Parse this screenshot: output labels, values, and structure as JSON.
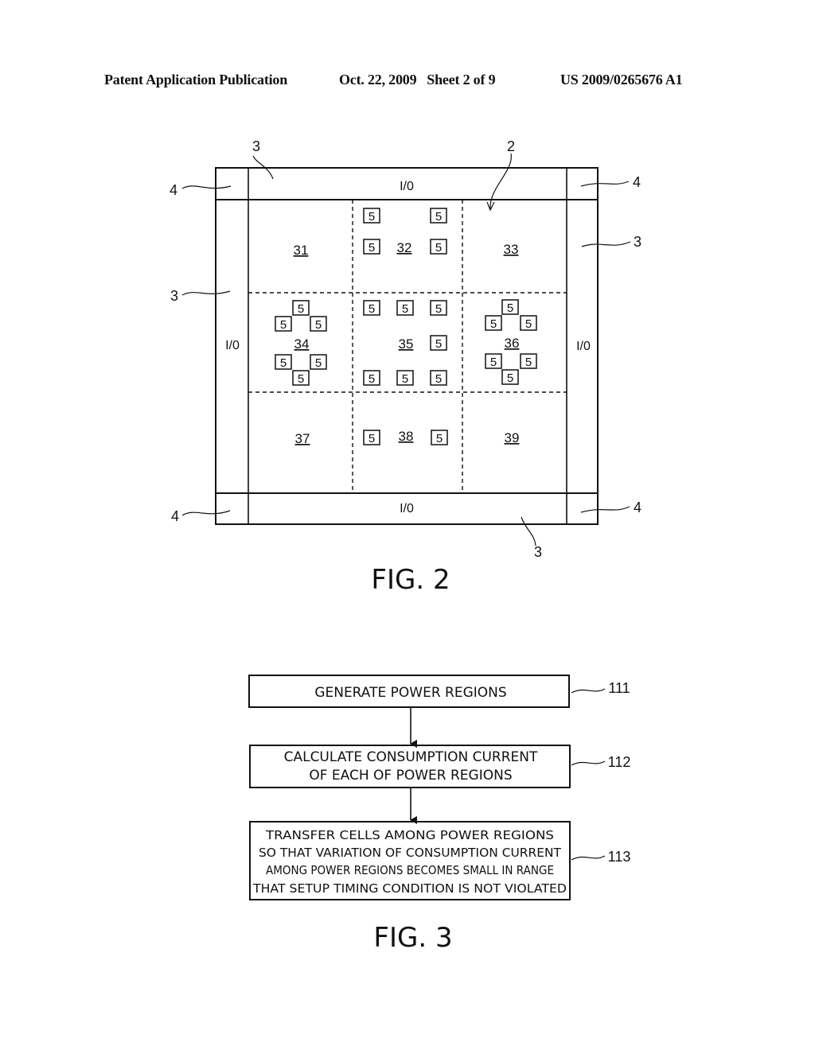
{
  "header": {
    "left": "Patent Application Publication",
    "center": "Oct. 22, 2009   Sheet 2 of 9",
    "right": "US 2009/0265676 A1"
  },
  "fig2": {
    "caption": "FIG. 2",
    "io_label": "I/0",
    "ref_chip": "2",
    "ref_io": "3",
    "ref_corner": "4",
    "cell_label": "5",
    "regions": [
      "31",
      "32",
      "33",
      "34",
      "35",
      "36",
      "37",
      "38",
      "39"
    ]
  },
  "fig3": {
    "caption": "FIG. 3",
    "steps": [
      {
        "ref": "111",
        "lines": [
          "GENERATE POWER REGIONS"
        ]
      },
      {
        "ref": "112",
        "lines": [
          "CALCULATE CONSUMPTION CURRENT",
          "OF EACH OF POWER REGIONS"
        ]
      },
      {
        "ref": "113",
        "lines": [
          "TRANSFER CELLS AMONG POWER REGIONS",
          "SO THAT VARIATION OF CONSUMPTION CURRENT",
          "AMONG POWER REGIONS BECOMES SMALL IN RANGE",
          "THAT SETUP TIMING CONDITION IS NOT VIOLATED"
        ]
      }
    ]
  }
}
